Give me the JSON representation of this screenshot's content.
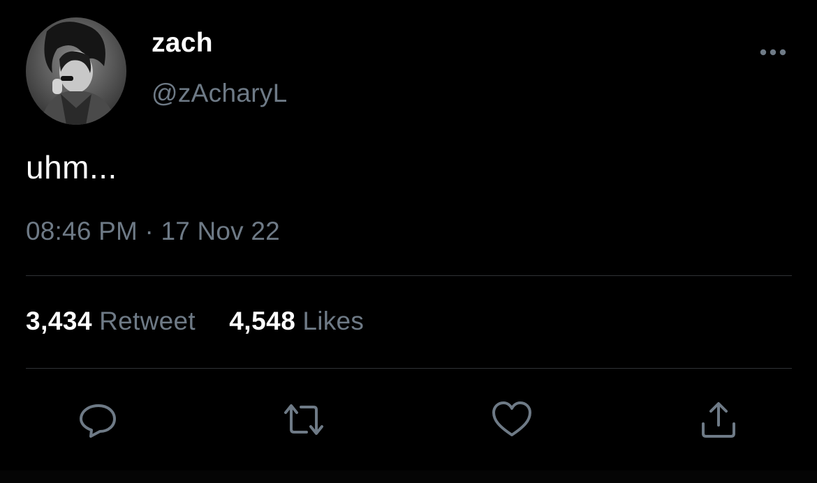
{
  "author": {
    "display_name": "zach",
    "handle": "@zAcharyL",
    "avatar_icon": "profile-photo"
  },
  "tweet": {
    "text": "uhm...",
    "timestamp": "08:46 PM · 17 Nov 22"
  },
  "stats": {
    "retweets_count": "3,434",
    "retweets_label": "Retweet",
    "likes_count": "4,548",
    "likes_label": "Likes"
  },
  "actions": {
    "reply_icon": "speech-bubble-icon",
    "retweet_icon": "retweet-arrows-icon",
    "like_icon": "heart-icon",
    "share_icon": "share-upload-icon",
    "more_icon": "ellipsis-icon"
  },
  "colors": {
    "background": "#000000",
    "primary_text": "#ffffff",
    "secondary_text": "#6e7a86",
    "divider": "#2f3336"
  }
}
